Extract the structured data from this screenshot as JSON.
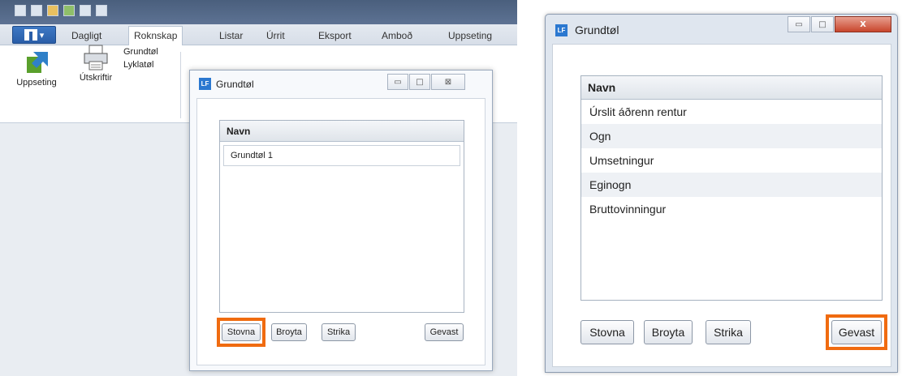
{
  "left_app": {
    "tabs": [
      "Dagligt",
      "Roknskap",
      "Listar",
      "Úrrit",
      "Eksport",
      "Amboð",
      "Uppseting"
    ],
    "active_tab": "Roknskap",
    "ribbon": {
      "uppseting_label": "Uppseting",
      "utskriftir_label": "Útskriftir",
      "grundtol_label": "Grundtøl",
      "lyklatol_label": "Lyklatøl"
    },
    "dialog": {
      "badge": "LF",
      "title": "Grundtøl",
      "column_header": "Navn",
      "rows": [
        "Grundtøl 1"
      ],
      "buttons": {
        "new": "Stovna",
        "edit": "Broyta",
        "delete": "Strika",
        "save": "Gevast"
      }
    }
  },
  "right_dialog": {
    "badge": "LF",
    "title": "Grundtøl",
    "close_glyph": "X",
    "column_header": "Navn",
    "rows": [
      "Úrslit áðrenn rentur",
      "Ogn",
      "Umsetningur",
      "Eginogn",
      "Bruttovinningur"
    ],
    "buttons": {
      "new": "Stovna",
      "edit": "Broyta",
      "delete": "Strika",
      "save": "Gevast"
    }
  },
  "colors": {
    "highlight": "#f06b10",
    "accent": "#2b78d0",
    "title_bar": "#4a5f7d"
  }
}
